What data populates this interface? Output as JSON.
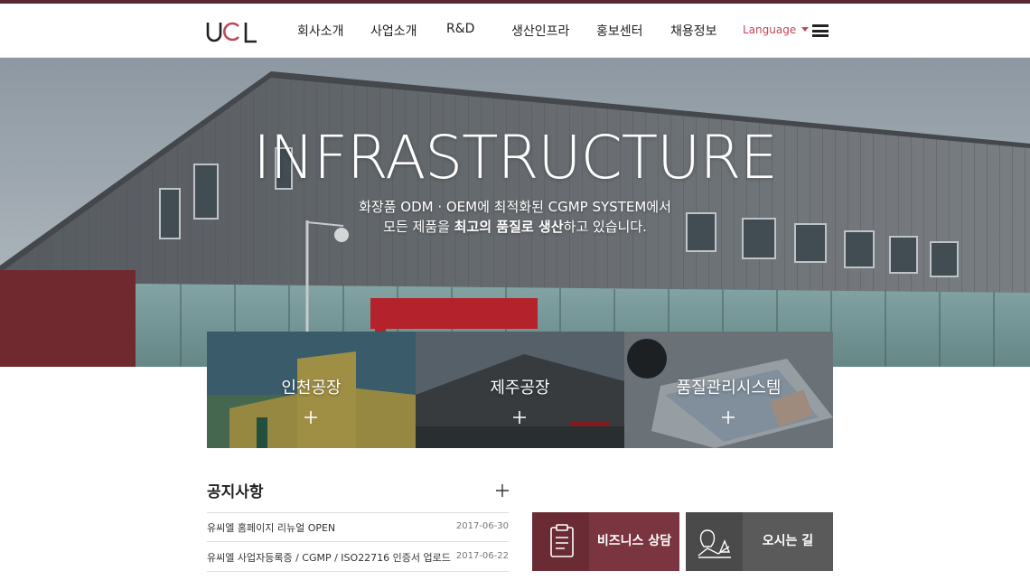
{
  "header": {
    "logo_text": "UCL",
    "nav": [
      {
        "label": "회사소개"
      },
      {
        "label": "사업소개"
      },
      {
        "label": "R&D"
      },
      {
        "label": "생산인프라"
      },
      {
        "label": "홍보센터"
      },
      {
        "label": "채용정보"
      }
    ],
    "language_label": "Language"
  },
  "hero": {
    "title": "INFRASTRUCTURE",
    "subtitle_line1": "화장품 ODM · OEM에 최적화된 CGMP SYSTEM에서",
    "subtitle_line2_pre": "모든 제품을 ",
    "subtitle_line2_bold": "최고의 품질로 생산",
    "subtitle_line2_post": "하고 있습니다."
  },
  "tiles": [
    {
      "label": "인천공장"
    },
    {
      "label": "제주공장"
    },
    {
      "label": "품질관리시스템"
    }
  ],
  "notice": {
    "title": "공지사항",
    "items": [
      {
        "title": "유씨엘 홈페이지 리뉴얼 OPEN",
        "date": "2017-06-30"
      },
      {
        "title": "유씨엘 사업자등록증 / CGMP / ISO22716 인증서 업로드",
        "date": "2017-06-22"
      }
    ]
  },
  "quick_links": [
    {
      "label": "비즈니스 상담",
      "icon": "clipboard-icon",
      "color": "#7a3540"
    },
    {
      "label": "오시는 길",
      "icon": "map-location-icon",
      "color": "#5a5a5a"
    }
  ],
  "colors": {
    "accent": "#c0485a",
    "topbar": "#5a2a33"
  }
}
